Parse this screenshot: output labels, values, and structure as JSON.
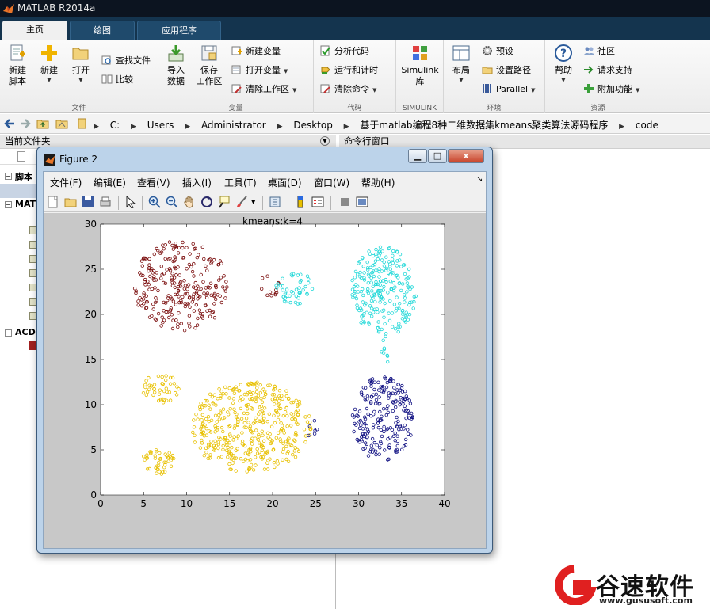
{
  "app": {
    "title": "MATLAB R2014a"
  },
  "tabs": [
    {
      "label": "主页"
    },
    {
      "label": "绘图"
    },
    {
      "label": "应用程序"
    }
  ],
  "ribbon": {
    "file": {
      "title": "文件",
      "new_script": "新建\n脚本",
      "new": "新建",
      "open": "打开",
      "find_files": "查找文件",
      "compare": "比较"
    },
    "variable": {
      "title": "变量",
      "import": "导入\n数据",
      "save_ws": "保存\n工作区",
      "new_var": "新建变量",
      "open_var": "打开变量",
      "clear_ws": "清除工作区"
    },
    "code": {
      "title": "代码",
      "analyze": "分析代码",
      "run_time": "运行和计时",
      "clear_cmd": "清除命令"
    },
    "simulink": {
      "title": "SIMULINK",
      "lib": "Simulink\n库"
    },
    "env": {
      "title": "环境",
      "layout": "布局",
      "prefs": "预设",
      "set_path": "设置路径",
      "parallel": "Parallel"
    },
    "resources": {
      "title": "资源",
      "help": "帮助",
      "community": "社区",
      "support": "请求支持",
      "addons": "附加功能"
    }
  },
  "address": {
    "path": [
      "C:",
      "Users",
      "Administrator",
      "Desktop",
      "基于matlab编程8种二维数据集kmeans聚类算法源码程序",
      "code"
    ]
  },
  "left_pane": {
    "title": "当前文件夹",
    "tree": [
      "脚本",
      "MAT",
      "ACD"
    ]
  },
  "cmd_pane": {
    "title": "命令行窗口"
  },
  "figure": {
    "title": "Figure 2",
    "menu": [
      "文件(F)",
      "编辑(E)",
      "查看(V)",
      "插入(I)",
      "工具(T)",
      "桌面(D)",
      "窗口(W)",
      "帮助(H)"
    ],
    "close_glyph": "x"
  },
  "chart_data": {
    "type": "scatter",
    "title": "kmeans:k=4",
    "xlabel": "",
    "ylabel": "",
    "xlim": [
      0,
      40
    ],
    "ylim": [
      0,
      30
    ],
    "xticks": [
      0,
      5,
      10,
      15,
      20,
      25,
      30,
      35,
      40
    ],
    "yticks": [
      0,
      5,
      10,
      15,
      20,
      25,
      30
    ],
    "marker": "open-circle",
    "series": [
      {
        "color": "#7a0c0c",
        "regions": [
          {
            "shape": "blob",
            "cx": 9.5,
            "cy": 23.2,
            "rx": 5.8,
            "ry": 5.0,
            "n": 260
          },
          {
            "shape": "blob",
            "cx": 19.7,
            "cy": 23.3,
            "rx": 1.2,
            "ry": 1.4,
            "n": 12
          }
        ]
      },
      {
        "color": "#21d8d8",
        "regions": [
          {
            "shape": "blob",
            "cx": 22.6,
            "cy": 23.0,
            "rx": 2.2,
            "ry": 1.9,
            "n": 45
          },
          {
            "shape": "blob",
            "cx": 32.9,
            "cy": 22.5,
            "rx": 3.8,
            "ry": 5.0,
            "n": 230
          },
          {
            "shape": "stem",
            "cx": 33.0,
            "cy": 16.2,
            "rx": 0.4,
            "ry": 1.5,
            "n": 8
          }
        ]
      },
      {
        "color": "#e8c000",
        "regions": [
          {
            "shape": "blob",
            "cx": 17.5,
            "cy": 7.5,
            "rx": 7.0,
            "ry": 5.0,
            "n": 420
          },
          {
            "shape": "blob",
            "cx": 7.0,
            "cy": 11.8,
            "rx": 2.2,
            "ry": 1.6,
            "n": 45
          },
          {
            "shape": "blob",
            "cx": 6.8,
            "cy": 3.7,
            "rx": 2.0,
            "ry": 1.5,
            "n": 45
          }
        ]
      },
      {
        "color": "#0d0d80",
        "regions": [
          {
            "shape": "blob",
            "cx": 32.8,
            "cy": 8.5,
            "rx": 3.6,
            "ry": 4.7,
            "n": 210
          },
          {
            "shape": "blob",
            "cx": 24.6,
            "cy": 7.2,
            "rx": 0.6,
            "ry": 1.4,
            "n": 6
          }
        ]
      }
    ]
  },
  "watermark": {
    "brand": "谷速软件",
    "url": "www.gususoft.com"
  }
}
